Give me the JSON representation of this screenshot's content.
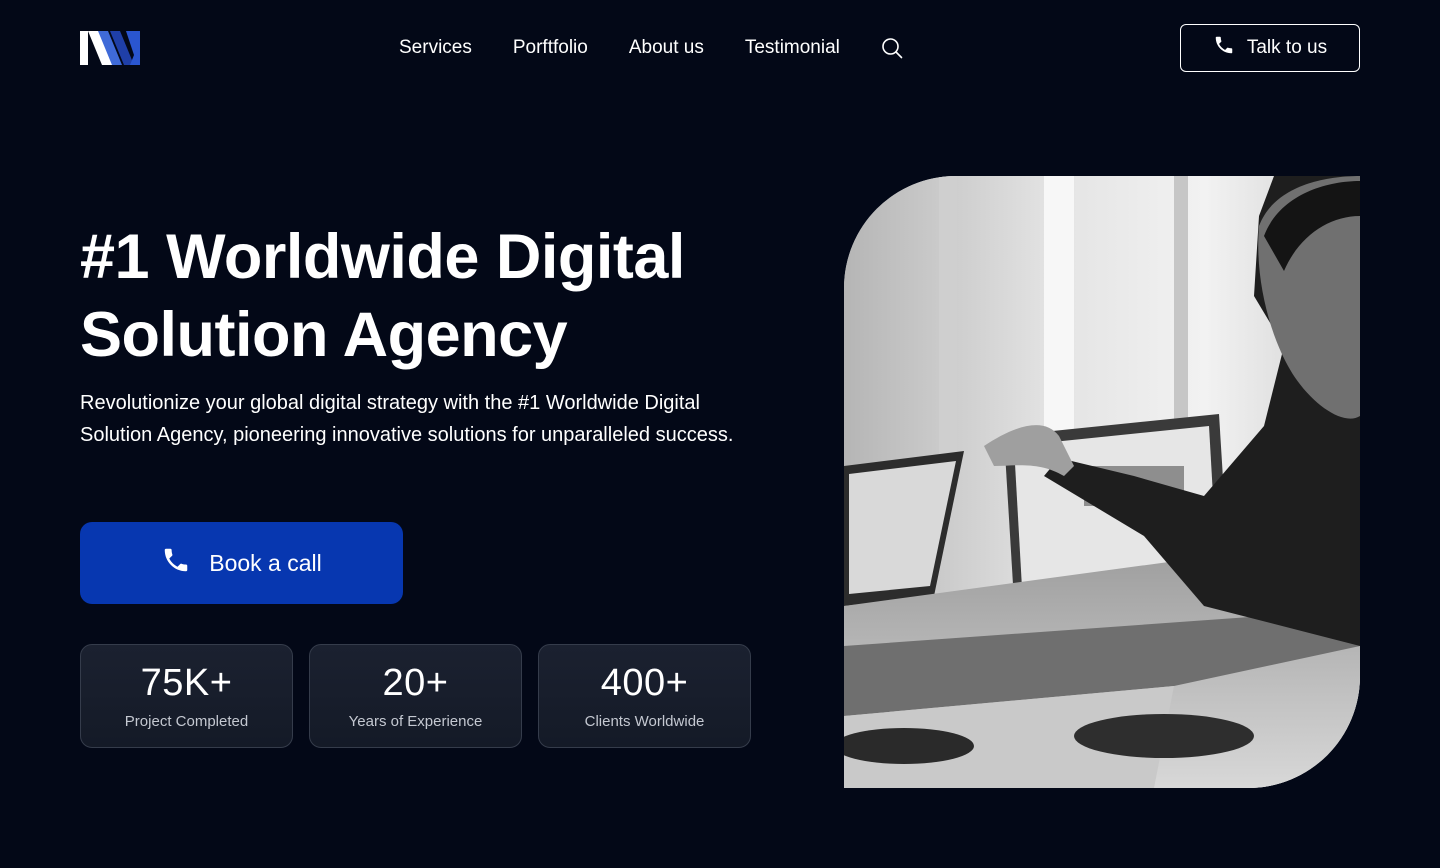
{
  "header": {
    "logo_icon": "brand-logo-icon",
    "nav_items": [
      {
        "label": "Services"
      },
      {
        "label": "Porftfolio"
      },
      {
        "label": "About us"
      },
      {
        "label": "Testimonial"
      }
    ],
    "search_icon": "search-icon",
    "cta": {
      "label": "Talk to us",
      "icon": "phone-icon"
    }
  },
  "hero": {
    "title_line1": "#1 Worldwide Digital",
    "title_line2": "Solution Agency",
    "description": "Revolutionize your global digital strategy with the #1 Worldwide Digital Solution Agency, pioneering innovative solutions for unparalleled success.",
    "button": {
      "label": "Book a call",
      "icon": "phone-icon"
    },
    "image_alt": "photo-of-man-working-on-laptop"
  },
  "stats": [
    {
      "value": "75K+",
      "label": "Project Completed"
    },
    {
      "value": "20+",
      "label": "Years of Experience"
    },
    {
      "value": "400+",
      "label": "Clients Worldwide"
    }
  ],
  "colors": {
    "background": "#030817",
    "primary": "#0737b0",
    "logo_light": "#ffffff",
    "logo_mid": "#3f6ad8",
    "logo_dark": "#1f3fa8",
    "stat_card": "#1a1f2c"
  }
}
